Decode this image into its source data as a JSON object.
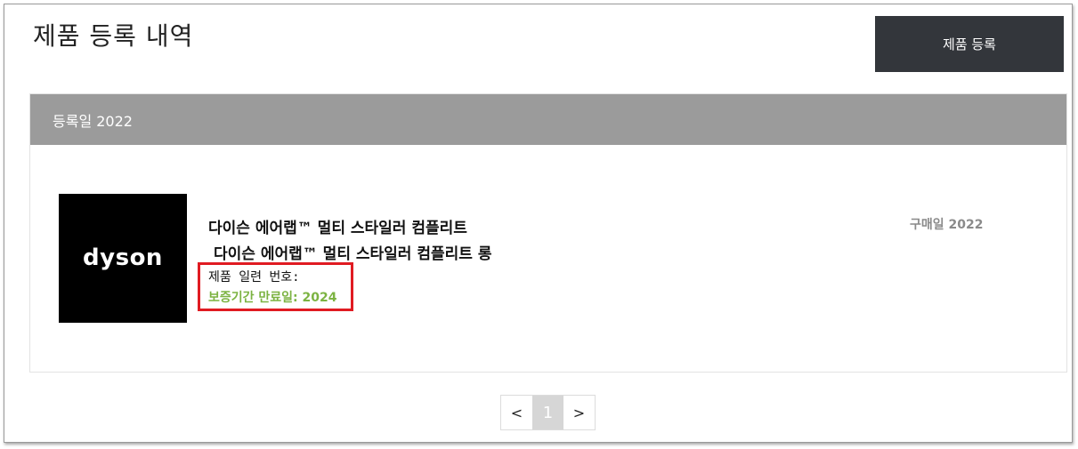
{
  "header": {
    "title": "제품 등록 내역",
    "register_button": "제품 등록"
  },
  "card": {
    "header_label": "등록일 2022",
    "product": {
      "image_alt": "dyson",
      "logo_text": "dyson",
      "name": "다이슨 에어랩™ 멀티 스타일러 컴플리트",
      "subname": "다이슨 에어랩™ 멀티 스타일러 컴플리트 롱",
      "serial_label": "제품 일련 번호:",
      "warranty_label": "보증기간 만료일: 2024",
      "purchase_label": "구매일 2022"
    }
  },
  "pagination": {
    "prev": "<",
    "current": "1",
    "next": ">"
  },
  "colors": {
    "button_bg": "#33363b",
    "header_bg": "#9b9b9b",
    "warranty_green": "#7cb342",
    "highlight_red": "#e01b22"
  }
}
